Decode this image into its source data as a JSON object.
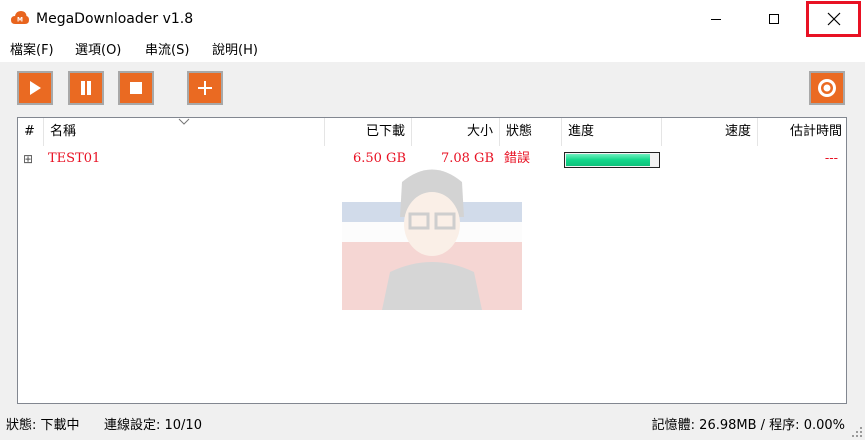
{
  "window": {
    "title": "MegaDownloader v1.8",
    "app_icon": "mega-cloud-icon",
    "controls": [
      "minimize-icon",
      "maximize-icon",
      "close-icon"
    ],
    "highlight_color": "#e81123"
  },
  "menu": {
    "items": [
      "檔案(F)",
      "選項(O)",
      "串流(S)",
      "說明(H)"
    ]
  },
  "toolbar": {
    "accent": "#ea6a22",
    "buttons": [
      "play-icon",
      "pause-icon",
      "stop-icon",
      "add-icon"
    ],
    "settings_button": "settings-icon"
  },
  "list": {
    "columns": [
      "#",
      "名稱",
      "已下載",
      "大小",
      "狀態",
      "進度",
      "速度",
      "估計時間"
    ],
    "rows": [
      {
        "expand": "⊞",
        "name": "TEST01",
        "downloaded": "6.50 GB",
        "size": "7.08 GB",
        "status": "錯誤",
        "progress": 0.918,
        "speed": "",
        "eta": "---",
        "color": "#e81123"
      }
    ]
  },
  "status_bar": {
    "state": "狀態: 下載中",
    "connections": "連線設定: 10/10",
    "memory": "記憶體: 26.98MB / 程序: 0.00%"
  }
}
